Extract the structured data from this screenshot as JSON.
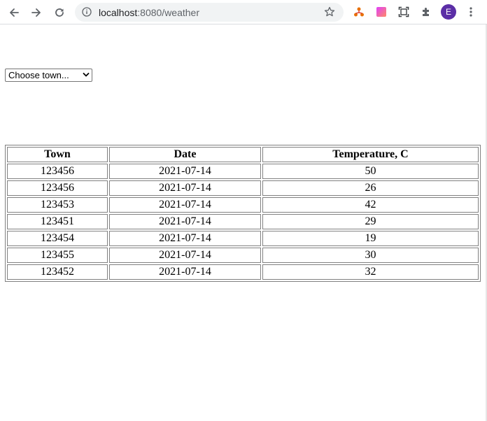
{
  "browser": {
    "url_host": "localhost",
    "url_rest": ":8080/weather",
    "profile_initial": "E",
    "accent": "#5b2ea6"
  },
  "page": {
    "town_select": {
      "selected": "Choose town...",
      "options": [
        "Choose town..."
      ]
    },
    "table": {
      "headers": [
        "Town",
        "Date",
        "Temperature, C"
      ],
      "rows": [
        [
          "123456",
          "2021-07-14",
          "50"
        ],
        [
          "123456",
          "2021-07-14",
          "26"
        ],
        [
          "123453",
          "2021-07-14",
          "42"
        ],
        [
          "123451",
          "2021-07-14",
          "29"
        ],
        [
          "123454",
          "2021-07-14",
          "19"
        ],
        [
          "123455",
          "2021-07-14",
          "30"
        ],
        [
          "123452",
          "2021-07-14",
          "32"
        ]
      ]
    }
  }
}
